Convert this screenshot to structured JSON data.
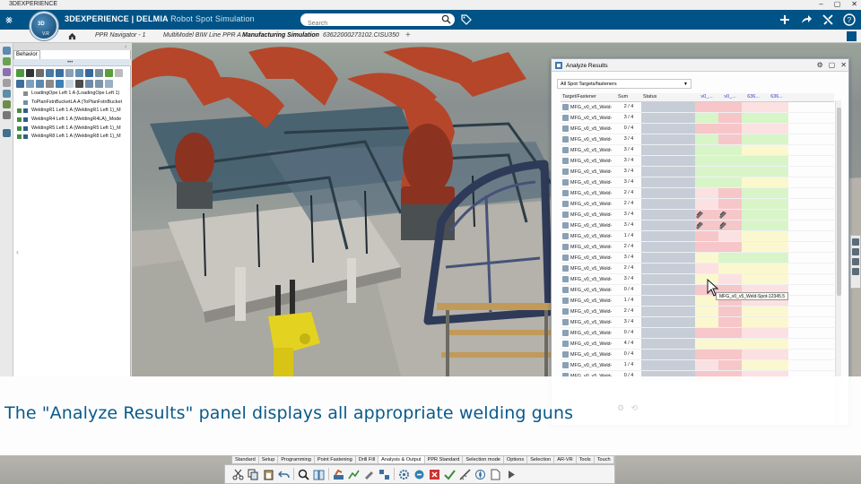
{
  "window": {
    "title": "3DEXPERIENCE"
  },
  "topbar": {
    "brand": "3DEXPERIENCE | DELMIA",
    "app_name": "Robot Spot Simulation",
    "search_placeholder": "Search",
    "compass_text": "3D",
    "compass_version": "V.R",
    "bg_color": "#005386"
  },
  "tabs": [
    {
      "label": "PPR Navigator - 1"
    },
    {
      "label": "MultiModel BIW Line PPR A"
    },
    {
      "label": "Manufacturing Simulation"
    },
    {
      "label": "63622000273102.CISU350"
    }
  ],
  "active_tab_index": 2,
  "behavior": {
    "tab_label": "Behavior",
    "more": "•••",
    "items": [
      {
        "label": "LoadingOpe Left 1 A (LoadingOpe Left 1)"
      },
      {
        "label": "ToPlanFstnBucketLA A (ToPlanFstnBucket"
      },
      {
        "label": "WeldingR1 Left 1 A (WeldingR1 Left 1)_M"
      },
      {
        "label": "WeldingR4 Left 1 A (WeldingR4LA)_Mode"
      },
      {
        "label": "WeldingR5 Left 1 A (WeldingR5 Left 1)_M"
      },
      {
        "label": "WeldingR8 Left 1 A (WeldingR8 Left 1)_M"
      }
    ]
  },
  "analyze": {
    "title": "Analyze Results",
    "filter_value": "All Spot Targets/fasteners",
    "columns": [
      "Target/Fastener",
      "Sum",
      "Status",
      "v0_...",
      "v0_...",
      "636...",
      "636..."
    ],
    "rows": [
      {
        "name": "MFG_v0_v5_Weld-",
        "sum": "2 / 4",
        "cells": [
          "r",
          "r",
          "p",
          "p"
        ]
      },
      {
        "name": "MFG_v0_v5_Weld-",
        "sum": "3 / 4",
        "cells": [
          "g",
          "r",
          "g",
          "g"
        ]
      },
      {
        "name": "MFG_v0_v5_Weld-",
        "sum": "0 / 4",
        "cells": [
          "r",
          "r",
          "p",
          "p"
        ]
      },
      {
        "name": "MFG_v0_v5_Weld-",
        "sum": "3 / 4",
        "cells": [
          "g",
          "r",
          "g",
          "g"
        ]
      },
      {
        "name": "MFG_v0_v5_Weld-",
        "sum": "3 / 4",
        "cells": [
          "g",
          "g",
          "y",
          "y"
        ]
      },
      {
        "name": "MFG_v0_v5_Weld-",
        "sum": "3 / 4",
        "cells": [
          "g",
          "g",
          "g",
          "g"
        ]
      },
      {
        "name": "MFG_v0_v5_Weld-",
        "sum": "3 / 4",
        "cells": [
          "g",
          "g",
          "g",
          "g"
        ]
      },
      {
        "name": "MFG_v0_v5_Weld-",
        "sum": "3 / 4",
        "cells": [
          "g",
          "g",
          "y",
          "y"
        ]
      },
      {
        "name": "MFG_v0_v5_Weld-",
        "sum": "2 / 4",
        "cells": [
          "p",
          "r",
          "g",
          "g"
        ]
      },
      {
        "name": "MFG_v0_v5_Weld-",
        "sum": "2 / 4",
        "cells": [
          "p",
          "r",
          "g",
          "g"
        ]
      },
      {
        "name": "MFG_v0_v5_Weld-",
        "sum": "3 / 4",
        "cells": [
          "gun",
          "gun",
          "g",
          "g"
        ]
      },
      {
        "name": "MFG_v0_v5_Weld-",
        "sum": "3 / 4",
        "cells": [
          "gun",
          "gun",
          "g",
          "g"
        ]
      },
      {
        "name": "MFG_v0_v5_Weld-",
        "sum": "1 / 4",
        "cells": [
          "r",
          "p",
          "y",
          "y"
        ]
      },
      {
        "name": "MFG_v0_v5_Weld-",
        "sum": "2 / 4",
        "cells": [
          "r",
          "r",
          "y",
          "y"
        ]
      },
      {
        "name": "MFG_v0_v5_Weld-",
        "sum": "3 / 4",
        "cells": [
          "y",
          "g",
          "g",
          "g"
        ]
      },
      {
        "name": "MFG_v0_v5_Weld-",
        "sum": "2 / 4",
        "cells": [
          "p",
          "y",
          "y",
          "y"
        ]
      },
      {
        "name": "MFG_v0_v5_Weld-",
        "sum": "3 / 4",
        "cells": [
          "y",
          "p",
          "y",
          "y"
        ]
      },
      {
        "name": "MFG_v0_v5_Weld-",
        "sum": "0 / 4",
        "cells": [
          "r",
          "r",
          "p",
          "p"
        ]
      },
      {
        "name": "MFG_v0_v5_Weld-",
        "sum": "1 / 4",
        "cells": [
          "y",
          "r",
          "p",
          "p"
        ]
      },
      {
        "name": "MFG_v0_v5_Weld-",
        "sum": "2 / 4",
        "cells": [
          "y",
          "r",
          "y",
          "y"
        ]
      },
      {
        "name": "MFG_v0_v5_Weld-",
        "sum": "3 / 4",
        "cells": [
          "y",
          "r",
          "y",
          "y"
        ]
      },
      {
        "name": "MFG_v0_v5_Weld-",
        "sum": "0 / 4",
        "cells": [
          "r",
          "r",
          "p",
          "p"
        ]
      },
      {
        "name": "MFG_v0_v5_Weld-",
        "sum": "4 / 4",
        "cells": [
          "y",
          "y",
          "y",
          "y"
        ]
      },
      {
        "name": "MFG_v0_v5_Weld-",
        "sum": "0 / 4",
        "cells": [
          "r",
          "r",
          "p",
          "p"
        ]
      },
      {
        "name": "MFG_v0_v5_Weld-",
        "sum": "1 / 4",
        "cells": [
          "p",
          "r",
          "y",
          "y"
        ]
      },
      {
        "name": "MFG_v0_v5_Weld-",
        "sum": "0 / 4",
        "cells": [
          "r",
          "r",
          "p",
          "p"
        ]
      }
    ],
    "tooltip": "MFG_v0_v5_Weld-Spot-12345.5",
    "colors": {
      "r": "#f7c6c9",
      "p": "#fbe1e2",
      "g": "#d8f5c8",
      "y": "#fbf8cf",
      "status": "#c7cdd6"
    }
  },
  "caption": "The \"Analyze Results\" panel displays all appropriate welding guns",
  "command_tabs": [
    "Standard",
    "Setup",
    "Programming",
    "Point Fastening",
    "Drill Fill",
    "Analysis & Output",
    "PPR Standard",
    "Selection mode",
    "Options",
    "Selection",
    "AR-VR",
    "Tools",
    "Touch"
  ],
  "active_command_tab": "Analysis & Output"
}
